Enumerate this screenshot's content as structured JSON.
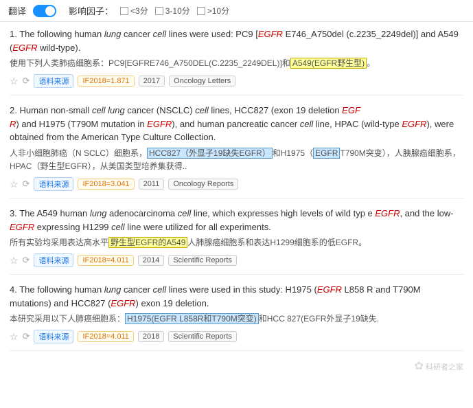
{
  "header": {
    "translate_label": "翻译",
    "impact_label": "影响因子：",
    "filters": [
      {
        "label": "<3分",
        "checked": false
      },
      {
        "label": "3-10分",
        "checked": false
      },
      {
        "label": ">10分",
        "checked": false
      }
    ]
  },
  "results": [
    {
      "number": "1.",
      "english": "The following human lung cancer cell lines were used: PC9 [EGFR E746_A750del (c.2235_2249del)] and A549 (EGFR wild-type).",
      "chinese": "使用下列人类肺癌细胞系：PC9[EGFRE746_A750DEL(C.2235_2249DEL)]和 A549(EGFR野生型)。",
      "highlight_cn": "A549(EGFR野生型)",
      "star": "☆",
      "source_tag": "语料来源",
      "if_tag": "IF2018=1.871",
      "year_tag": "2017",
      "journal_tag": "Oncology Letters"
    },
    {
      "number": "2.",
      "english": "Human non-small cell lung cancer (NSCLC) cell lines, HCC827 (exon 19 deletion EGFR) and H1975 (T790M mutation in EGFR), and human pancreatic cancer cell line, HPAC (wild-type EGFR), were obtained from the American Type Culture Collection.",
      "chinese": "人非小细胞肺癌（N SCLC）细胞系，HCC827（外显子19缺失EGFR）和H1975（EGFR T790M突变），人胰腺癌细胞系，HPAC（野生型EGFR），从美国类型培养集获得.",
      "highlight_cn1": "HCC827（外显子19缺失EGFR）",
      "highlight_cn2": "H1975（EGFR",
      "star": "☆",
      "source_tag": "语料来源",
      "if_tag": "IF2018=3.041",
      "year_tag": "2011",
      "journal_tag": "Oncology Reports"
    },
    {
      "number": "3.",
      "english": "The A549 human lung adenocarcinoma cell line, which expresses high levels of wild type EGFR, and the low-EGFR expressing H1299 cell line were utilized for all experiments.",
      "chinese": "所有实验均采用表达高水平野生型EGFR的A549人肺腺癌细胞系和表达H1299细胞系的低EGFR。",
      "highlight_cn": "野生型EGFR的A549",
      "star": "☆",
      "source_tag": "语料来源",
      "if_tag": "IF2018=4.011",
      "year_tag": "2014",
      "journal_tag": "Scientific Reports"
    },
    {
      "number": "4.",
      "english": "The following human lung cancer cell lines were used in this study: H1975 (EGFR L858R and T790M mutations) and HCC827 (EGFR exon 19 deletion.",
      "chinese": "本研究采用以下人肺癌细胞系：H1975(EGFR L858R和T790M突变)和HCC 827(EGFR外显子19缺失.",
      "highlight_cn": "H1975(EGFR L858R和T790M突变)",
      "star": "☆",
      "source_tag": "语料来源",
      "if_tag": "IF2018=4.011",
      "year_tag": "2018",
      "journal_tag": "Scientific Reports"
    }
  ],
  "watermark": "科研者之家"
}
